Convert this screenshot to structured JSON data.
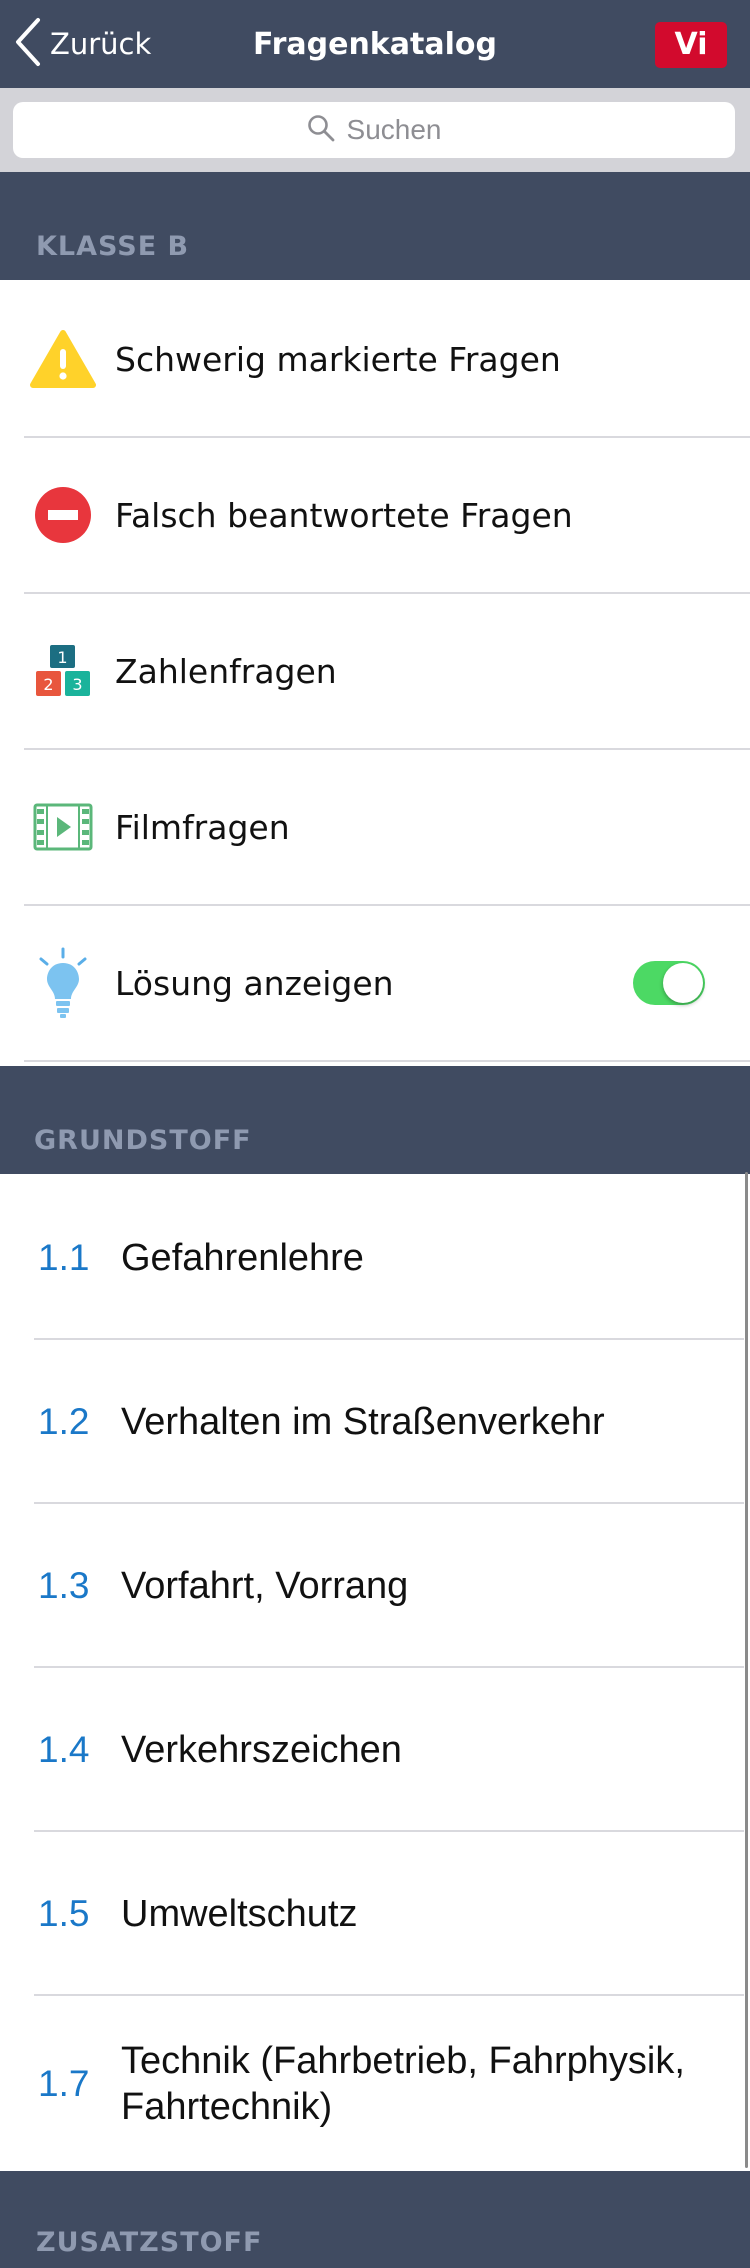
{
  "navbar": {
    "back_label": "Zurück",
    "title": "Fragenkatalog",
    "badge": "Vi"
  },
  "search": {
    "placeholder": "Suchen"
  },
  "sections": {
    "klasse_b": {
      "header": "KLASSE B",
      "items": [
        {
          "label": "Schwerig markierte Fragen",
          "icon": "warning-icon"
        },
        {
          "label": "Falsch beantwortete Fragen",
          "icon": "no-entry-icon"
        },
        {
          "label": "Zahlenfragen",
          "icon": "number-blocks-icon"
        },
        {
          "label": "Filmfragen",
          "icon": "film-icon"
        },
        {
          "label": "Lösung anzeigen",
          "icon": "lightbulb-icon",
          "toggle_on": true
        }
      ]
    },
    "grundstoff": {
      "header": "GRUNDSTOFF",
      "chapters": [
        {
          "num": "1.1",
          "title": "Gefahrenlehre"
        },
        {
          "num": "1.2",
          "title": "Verhalten im Straßenverkehr"
        },
        {
          "num": "1.3",
          "title": "Vorfahrt, Vorrang"
        },
        {
          "num": "1.4",
          "title": "Verkehrszeichen"
        },
        {
          "num": "1.5",
          "title": "Umweltschutz"
        },
        {
          "num": "1.7",
          "title": "Technik (Fahrbetrieb, Fahrphysik, Fahrtechnik)"
        }
      ]
    },
    "zusatzstoff": {
      "header": "ZUSATZSTOFF"
    }
  },
  "colors": {
    "navbar": "#404b61",
    "badge": "#d20a2d",
    "chapter_number": "#1a78c8",
    "toggle_on": "#4cd964"
  }
}
